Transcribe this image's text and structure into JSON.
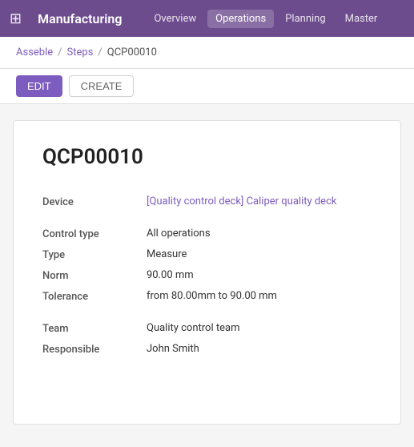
{
  "nav": {
    "brand": "Manufacturing",
    "links": [
      {
        "label": "Overview",
        "active": false
      },
      {
        "label": "Operations",
        "active": true
      },
      {
        "label": "Planning",
        "active": false
      },
      {
        "label": "Master",
        "active": false
      }
    ]
  },
  "breadcrumb": {
    "root": "Asseble",
    "separator1": "/",
    "middle": "Steps",
    "separator2": "/",
    "current": "QCP00010"
  },
  "actions": {
    "edit_label": "EDIT",
    "create_label": "CREATE"
  },
  "record": {
    "title": "QCP00010",
    "fields": {
      "device_label": "Device",
      "device_value": "[Quality control deck] Caliper quality deck",
      "control_type_label": "Control type",
      "control_type_value": "All operations",
      "type_label": "Type",
      "type_value": "Measure",
      "norm_label": "Norm",
      "norm_value": "90.00 mm",
      "tolerance_label": "Tolerance",
      "tolerance_value": "from 80.00mm to 90.00 mm",
      "team_label": "Team",
      "team_value": "Quality control team",
      "responsible_label": "Responsible",
      "responsible_value": "John Smith"
    }
  }
}
